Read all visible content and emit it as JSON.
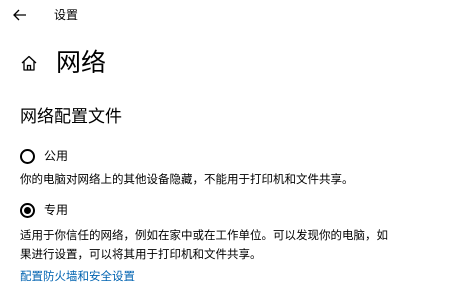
{
  "window": {
    "title": "设置"
  },
  "header": {
    "icon": "home-icon",
    "title": "网络"
  },
  "profile": {
    "section_title": "网络配置文件",
    "selected": "private",
    "options": [
      {
        "id": "public",
        "label": "公用",
        "description": "你的电脑对网络上的其他设备隐藏，不能用于打印机和文件共享。",
        "checked": false
      },
      {
        "id": "private",
        "label": "专用",
        "description_line1": "适用于你信任的网络，例如在家中或在工作单位。可以发现你的电脑，如",
        "description_line2": "果进行设置，可以将其用于打印机和文件共享。",
        "checked": true
      }
    ]
  },
  "link": {
    "label": "配置防火墙和安全设置"
  },
  "colors": {
    "link": "#0063b1",
    "text": "#000000",
    "background": "#ffffff"
  }
}
